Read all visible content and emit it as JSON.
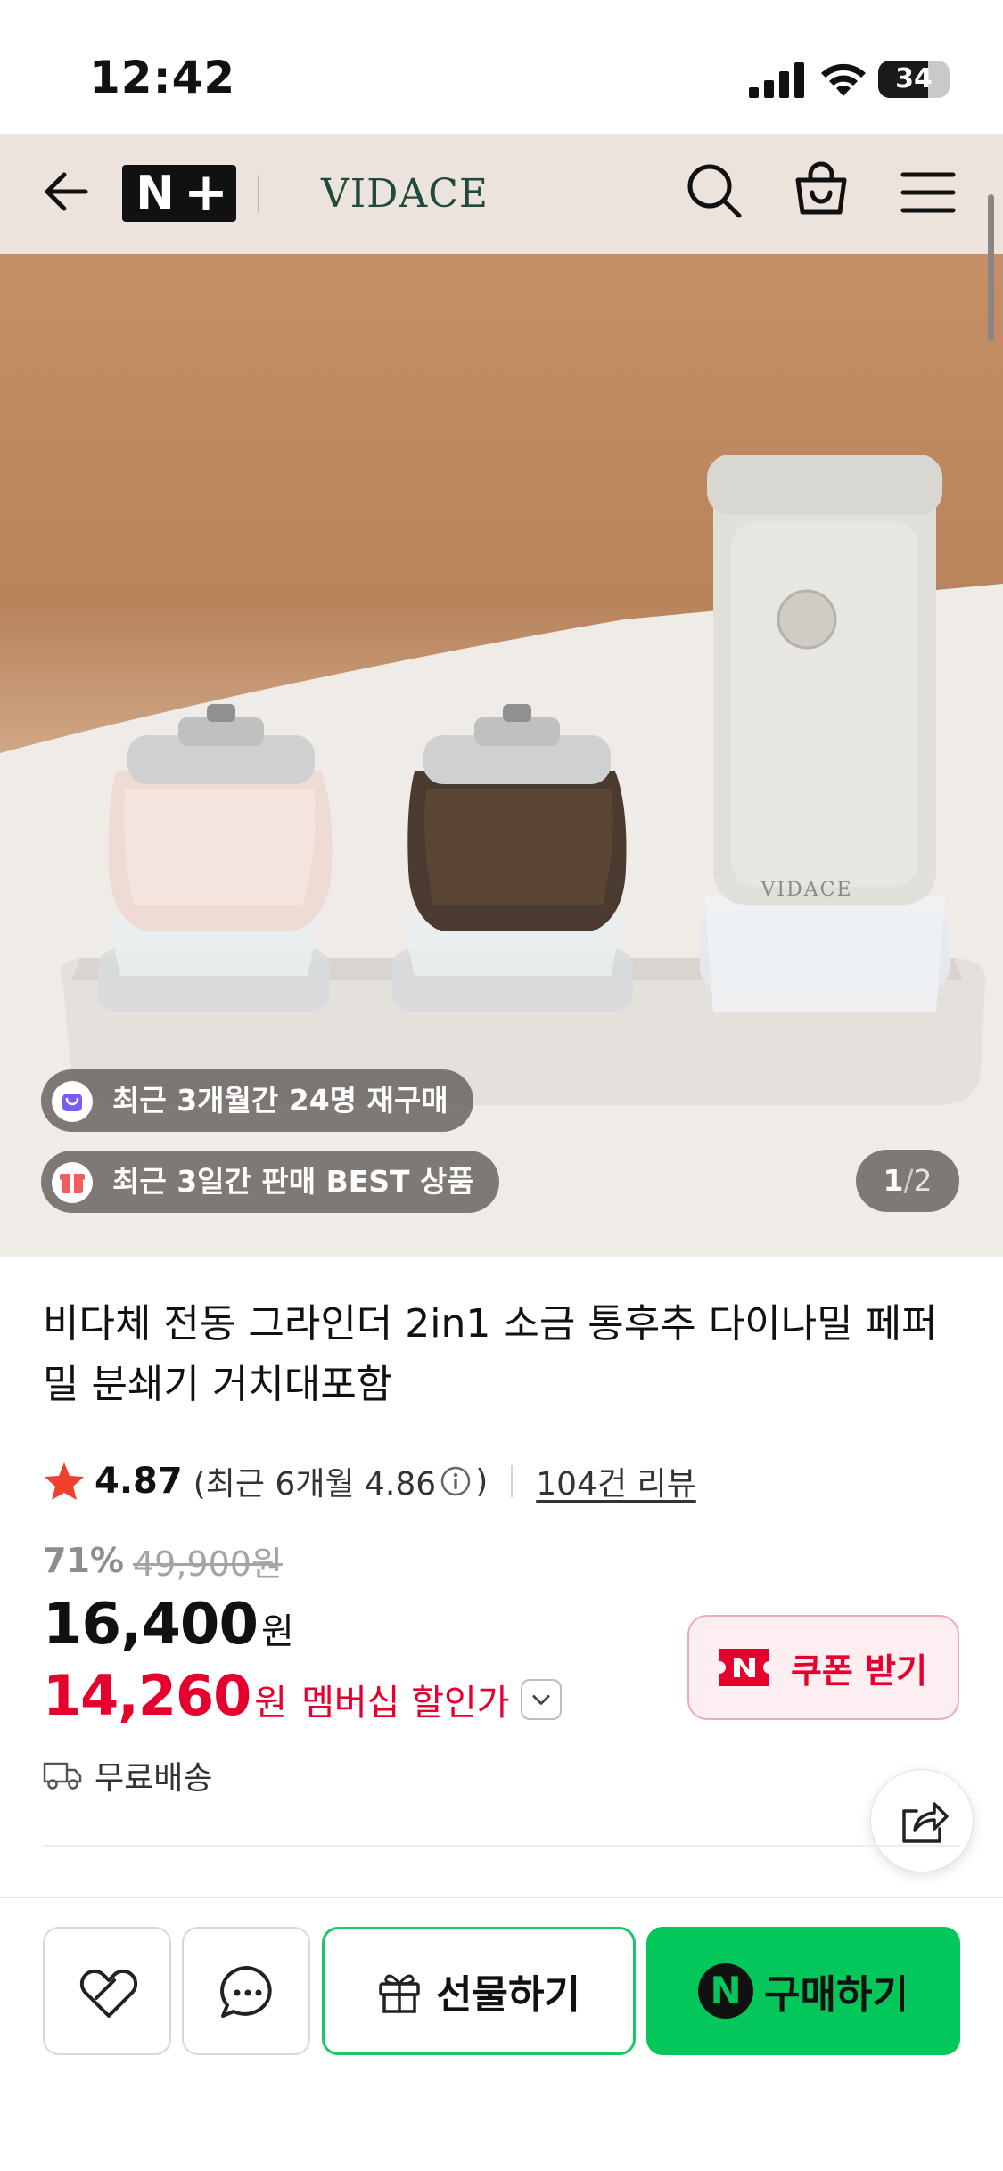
{
  "status_bar": {
    "time": "12:42",
    "battery_percent": "34"
  },
  "header": {
    "platform_logo": "N+",
    "brand_logo": "VIDACE",
    "icons": [
      "back-arrow-icon",
      "search-icon",
      "shopping-bag-icon",
      "hamburger-menu-icon"
    ]
  },
  "hero": {
    "product_brand_mark": "VIDACE",
    "badges": [
      {
        "text": "최근 3개월간 24명 재구매",
        "icon": "repurchase-bag-icon",
        "icon_color": "#7b5cf5"
      },
      {
        "text": "최근 3일간 판매 BEST 상품",
        "icon": "best-box-icon",
        "icon_color": "#f25c5c"
      }
    ],
    "page_current": "1",
    "page_separator": "/",
    "page_total": "2"
  },
  "product": {
    "title": "비다체 전동 그라인더 2in1 소금 통후추 다이나밀 페퍼밀 분쇄기 거치대포함",
    "rating": "4.87",
    "rating_recent_prefix": "(최근 6개월 4.86",
    "rating_recent_suffix": ")",
    "review_link": "104건 리뷰",
    "discount_rate": "71%",
    "original_price": "49,900원",
    "sale_price": "16,400",
    "currency": "원",
    "member_price": "14,260",
    "member_price_label": "멤버십 할인가",
    "coupon_label": "쿠폰 받기",
    "delivery": "무료배송"
  },
  "bottom_bar": {
    "gift_label": "선물하기",
    "buy_label": "구매하기"
  },
  "colors": {
    "naver_green": "#03c75a",
    "discount_red": "#e5002d",
    "star": "#f23e2e",
    "header_bg": "#ece4dc",
    "brand_green": "#1f4a3d"
  }
}
